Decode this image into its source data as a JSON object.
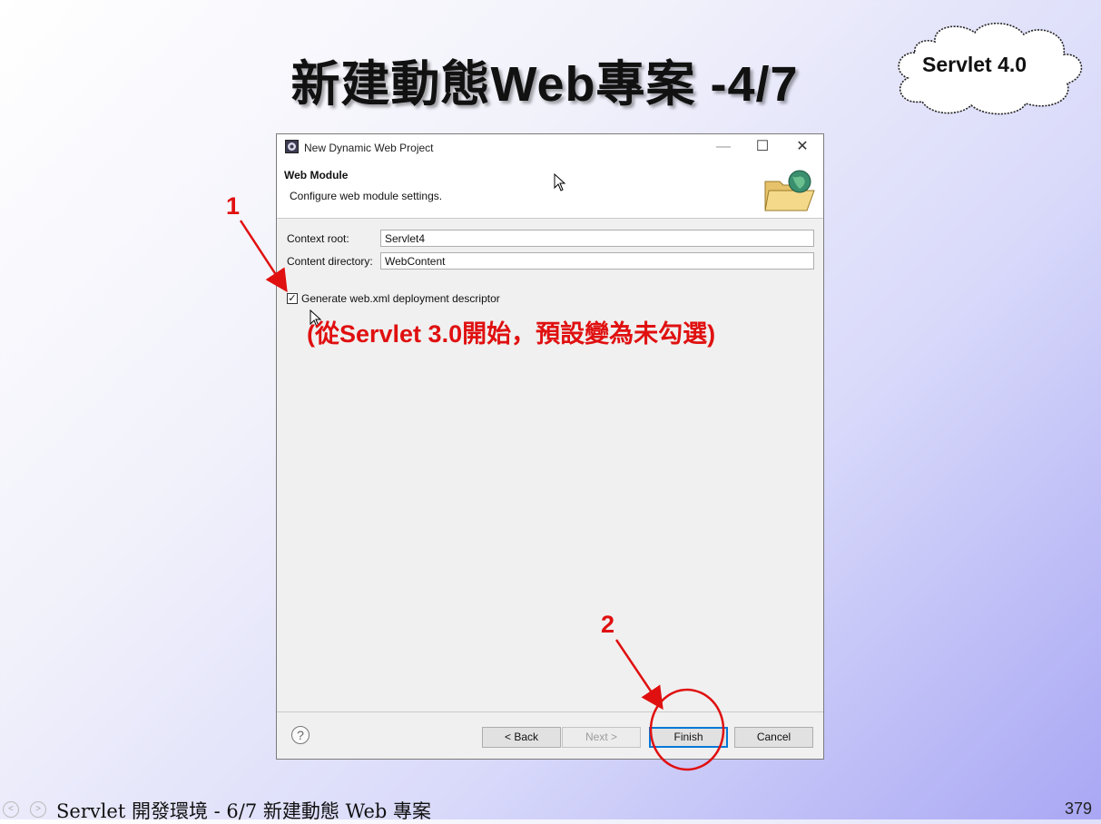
{
  "slide": {
    "title": "新建動態Web專案 -4/7",
    "cloud_label": "Servlet 4.0",
    "footer_text": "Servlet 開發環境 - 6/7 新建動態 Web 專案",
    "page_number": "379"
  },
  "dialog": {
    "window_title": "New Dynamic Web Project",
    "window_buttons": {
      "minimize": "—",
      "maximize": "☐",
      "close": "✕"
    },
    "header_title": "Web Module",
    "header_description": "Configure web module settings.",
    "context_root_label": "Context root:",
    "context_root_value": "Servlet4",
    "content_directory_label": "Content directory:",
    "content_directory_value": "WebContent",
    "generate_descriptor_label": "Generate web.xml deployment descriptor",
    "generate_descriptor_checked": true,
    "help": "?",
    "back_label": "< Back",
    "next_label": "Next >",
    "finish_label": "Finish",
    "cancel_label": "Cancel"
  },
  "annotations": {
    "marker_1": "1",
    "marker_2": "2",
    "note": "(從Servlet 3.0開始，預設變為未勾選)"
  },
  "colors": {
    "annotation": "#e01010",
    "default_button_border": "#0078d7"
  },
  "icons": [
    "app-icon",
    "folder-globe-icon",
    "help-icon",
    "mouse-cursor-icon"
  ]
}
